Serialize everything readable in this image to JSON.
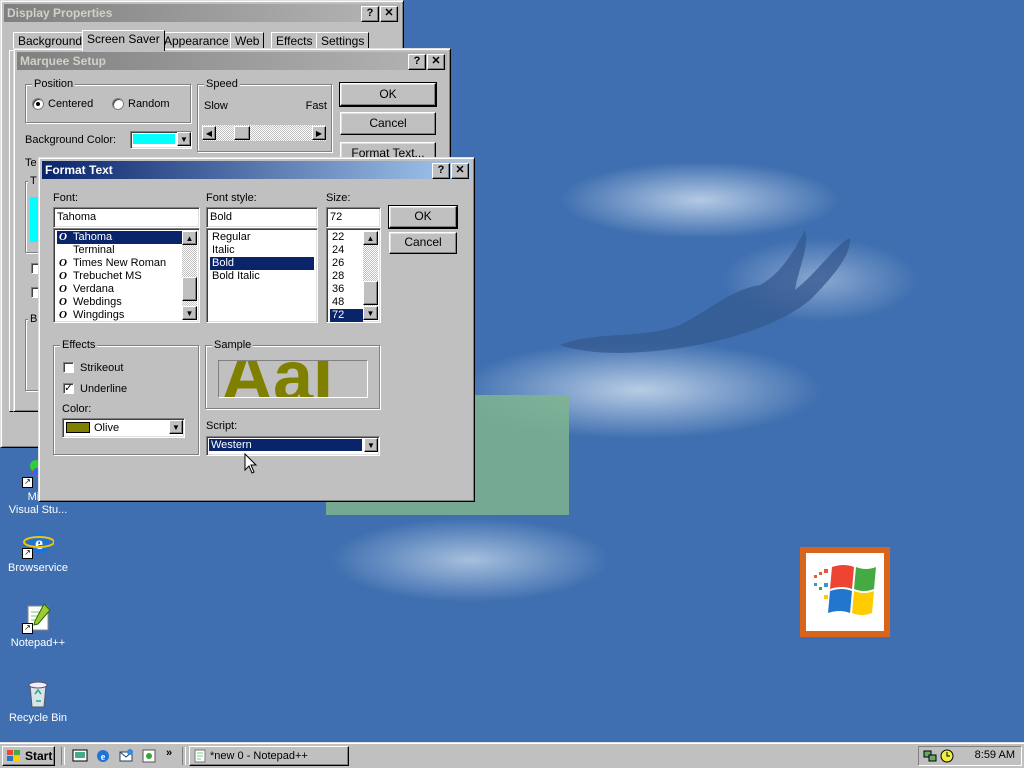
{
  "desktop": {
    "icons": [
      {
        "label": "Micr",
        "label2": "Visual Stu..."
      },
      {
        "label": "Browservice"
      },
      {
        "label": "Notepad++"
      },
      {
        "label": "Recycle Bin"
      }
    ]
  },
  "display_properties": {
    "title": "Display Properties",
    "tabs": [
      "Background",
      "Screen Saver",
      "Appearance",
      "Web",
      "Effects",
      "Settings"
    ],
    "active_tab": "Screen Saver"
  },
  "marquee_setup": {
    "title": "Marquee Setup",
    "position_group": "Position",
    "centered_label": "Centered",
    "random_label": "Random",
    "speed_group": "Speed",
    "slow_label": "Slow",
    "fast_label": "Fast",
    "background_color_label": "Background Color:",
    "background_color_value": "#00ffff",
    "text_label_fragment": "Te",
    "text_group_fragment": "T",
    "b_fragment": "B",
    "ok_label": "OK",
    "cancel_label": "Cancel",
    "format_text_label": "Format Text..."
  },
  "format_text": {
    "title": "Format Text",
    "font_label": "Font:",
    "font_value": "Tahoma",
    "fonts": [
      "Tahoma",
      "Terminal",
      "Times New Roman",
      "Trebuchet MS",
      "Verdana",
      "Webdings",
      "Wingdings"
    ],
    "selected_font": "Tahoma",
    "font_style_label": "Font style:",
    "font_style_value": "Bold",
    "styles": [
      "Regular",
      "Italic",
      "Bold",
      "Bold Italic"
    ],
    "selected_style": "Bold",
    "size_label": "Size:",
    "size_value": "72",
    "sizes": [
      "22",
      "24",
      "26",
      "28",
      "36",
      "48",
      "72"
    ],
    "selected_size": "72",
    "ok_label": "OK",
    "cancel_label": "Cancel",
    "effects_group": "Effects",
    "strikeout_label": "Strikeout",
    "strikeout_checked": false,
    "underline_label": "Underline",
    "underline_checked": true,
    "color_label": "Color:",
    "color_value": "Olive",
    "color_hex": "#808000",
    "sample_group": "Sample",
    "sample_text": "AaI",
    "script_label": "Script:",
    "script_value": "Western"
  },
  "taskbar": {
    "start_label": "Start",
    "task_label": "*new  0 - Notepad++",
    "clock": "8:59 AM"
  }
}
